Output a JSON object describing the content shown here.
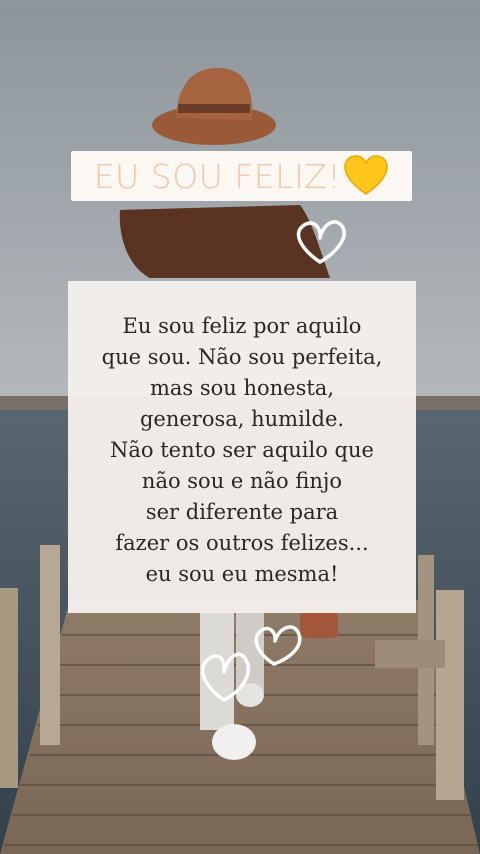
{
  "title": {
    "text": "EU SOU FELIZ!",
    "heart": "yellow-heart-emoji"
  },
  "quote": {
    "lines": [
      "Eu sou feliz por aquilo",
      "que sou. Não sou perfeita,",
      "mas sou honesta,",
      "generosa, humilde.",
      "Não tento ser aquilo que",
      "não sou e não finjo",
      "ser diferente para",
      "fazer os outros felizes...",
      "eu sou eu mesma!"
    ]
  },
  "colors": {
    "title_text": "#efc6a8",
    "title_bg": "#fbf7f3",
    "card_bg": "#f4efec",
    "quote_text": "#2b2622",
    "sky": "#9aa3ab",
    "sea": "#3d4c58",
    "pier": "#8a7765"
  }
}
